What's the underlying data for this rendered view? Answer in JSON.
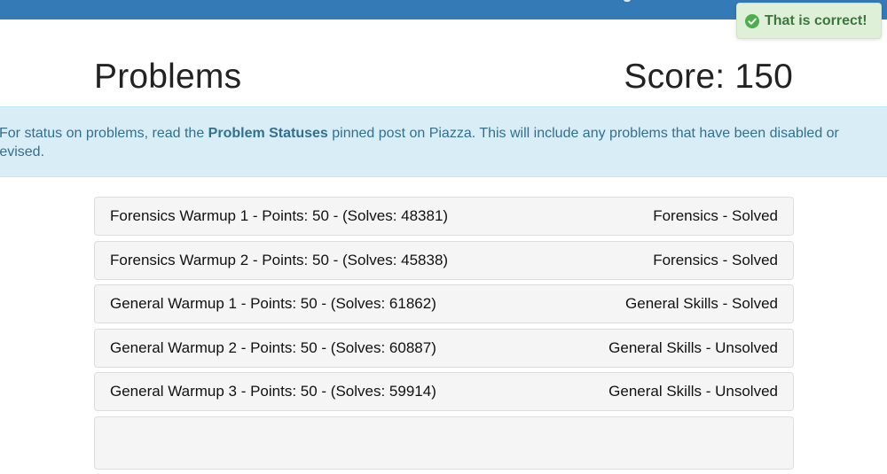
{
  "toast": {
    "message": "That is correct!",
    "color": "#3c763d",
    "background": "#dff0d8"
  },
  "header": {
    "title": "Problems",
    "score": "Score: 150"
  },
  "notice": {
    "before": "For status on problems, read the ",
    "link": "Problem Statuses",
    "after_line1": " pinned post on Piazza. This will include any problems that have been disabled or",
    "line2": "revised."
  },
  "problems": [
    {
      "name": "Forensics Warmup 1 - Points: 50 - (Solves: 48381)",
      "status": "Forensics - Solved"
    },
    {
      "name": "Forensics Warmup 2 - Points: 50 - (Solves: 45838)",
      "status": "Forensics - Solved"
    },
    {
      "name": "General Warmup 1 - Points: 50 - (Solves: 61862)",
      "status": "General Skills - Solved"
    },
    {
      "name": "General Warmup 2 - Points: 50 - (Solves: 60887)",
      "status": "General Skills - Unsolved"
    },
    {
      "name": "General Warmup 3 - Points: 50 - (Solves: 59914)",
      "status": "General Skills - Unsolved"
    }
  ],
  "colors": {
    "navbar": "#337ab7",
    "info_background": "#d9edf7",
    "info_text": "#31708f"
  },
  "icons": {
    "toast_icon": "check-circle-icon"
  }
}
